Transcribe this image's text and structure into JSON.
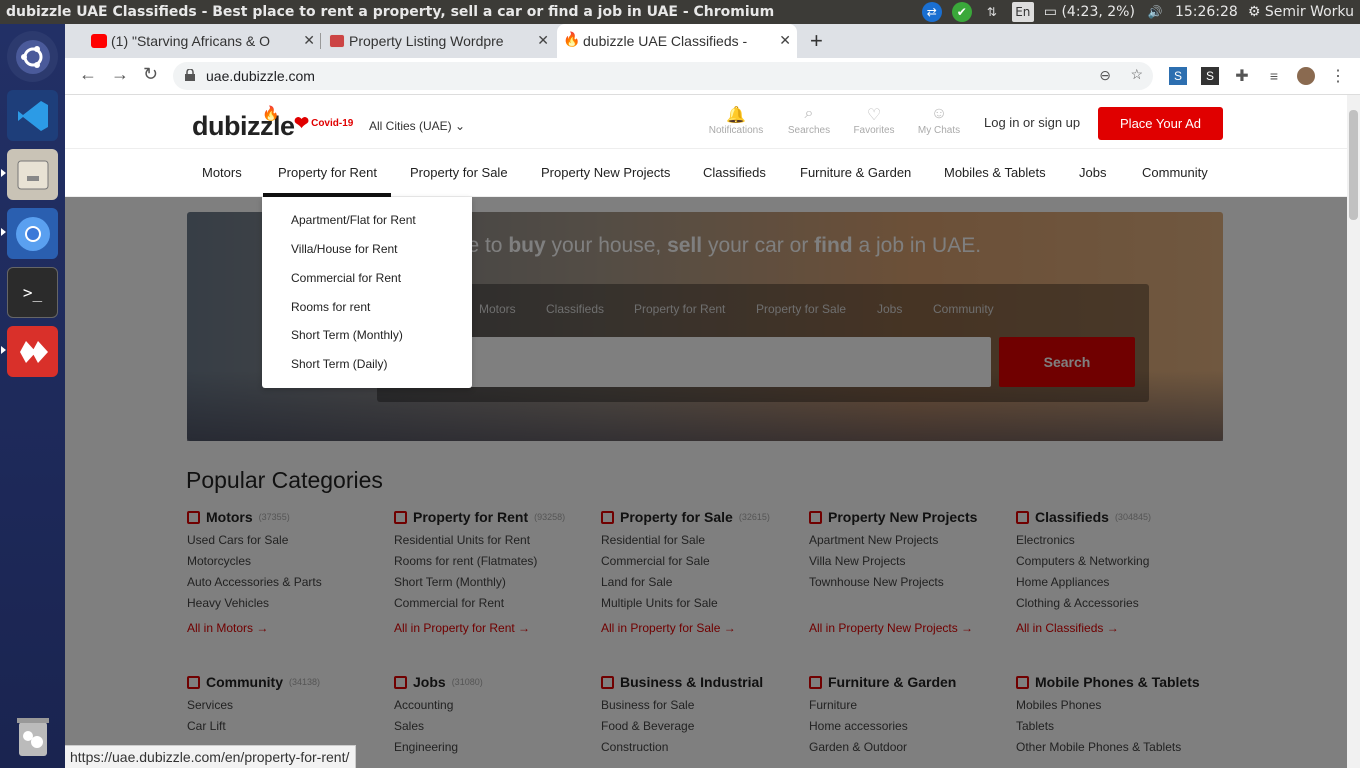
{
  "window": {
    "title": "dubizzle UAE Classifieds - Best place to rent a property, sell a car or find a job in UAE - Chromium",
    "tray": {
      "lang": "En",
      "battery": "(4:23, 2%)",
      "time": "15:26:28",
      "user": "Semir Worku"
    }
  },
  "tabs": [
    {
      "label": "(1) \"Starving Africans & O",
      "favicon_color": "#ff0000"
    },
    {
      "label": "Property Listing Wordpre",
      "favicon_color": "#d44"
    },
    {
      "label": "dubizzle UAE Classifieds -",
      "favicon_color": "#e00000"
    }
  ],
  "omnibox": {
    "url": "uae.dubizzle.com"
  },
  "site": {
    "logo": "dubizzle",
    "covid": "Covid-19",
    "city_selector": "All Cities (UAE)",
    "header_icons": [
      {
        "label": "Notifications",
        "icon": "bell-icon",
        "glyph": "🔔"
      },
      {
        "label": "Searches",
        "icon": "search-icon",
        "glyph": "⌕"
      },
      {
        "label": "Favorites",
        "icon": "heart-icon",
        "glyph": "♡"
      },
      {
        "label": "My Chats",
        "icon": "chat-icon",
        "glyph": "☺"
      }
    ],
    "login": "Log in or sign up",
    "place_ad": "Place Your Ad",
    "nav": [
      "Motors",
      "Property for Rent",
      "Property for Sale",
      "Property New Projects",
      "Classifieds",
      "Furniture & Garden",
      "Mobiles & Tablets",
      "Jobs",
      "Community"
    ],
    "dropdown": [
      "Apartment/Flat for Rent",
      "Villa/House for Rent",
      "Commercial for Rent",
      "Rooms for rent",
      "Short Term (Monthly)",
      "Short Term (Daily)"
    ],
    "hero": {
      "tag_prefix": "place to ",
      "tag_buy": "buy",
      "tag_mid1": " your house, ",
      "tag_sell": "sell",
      "tag_mid2": " your car or ",
      "tag_find": "find",
      "tag_suffix": " a job in UAE.",
      "panel_tabs": [
        "Motors",
        "Classifieds",
        "Property for Rent",
        "Property for Sale",
        "Jobs",
        "Community"
      ],
      "search_button": "Search"
    },
    "popular_title": "Popular Categories",
    "categories_row1": [
      {
        "title": "Motors",
        "count": "(37355)",
        "links": [
          "Used Cars for Sale",
          "Motorcycles",
          "Auto Accessories & Parts",
          "Heavy Vehicles"
        ],
        "all": "All in Motors →"
      },
      {
        "title": "Property for Rent",
        "count": "(93258)",
        "links": [
          "Residential Units for Rent",
          "Rooms for rent (Flatmates)",
          "Short Term (Monthly)",
          "Commercial for Rent"
        ],
        "all": "All in Property for Rent →"
      },
      {
        "title": "Property for Sale",
        "count": "(32615)",
        "links": [
          "Residential for Sale",
          "Commercial for Sale",
          "Land for Sale",
          "Multiple Units for Sale"
        ],
        "all": "All in Property for Sale →"
      },
      {
        "title": "Property New Projects",
        "count": "",
        "links": [
          "Apartment New Projects",
          "Villa New Projects",
          "Townhouse New Projects",
          ""
        ],
        "all": "All in Property New Projects →"
      },
      {
        "title": "Classifieds",
        "count": "(304845)",
        "links": [
          "Electronics",
          "Computers & Networking",
          "Home Appliances",
          "Clothing & Accessories"
        ],
        "all": "All in Classifieds →"
      }
    ],
    "categories_row2": [
      {
        "title": "Community",
        "count": "(34138)",
        "links": [
          "Services",
          "Car Lift"
        ]
      },
      {
        "title": "Jobs",
        "count": "(31080)",
        "links": [
          "Accounting",
          "Sales",
          "Engineering"
        ]
      },
      {
        "title": "Business & Industrial",
        "count": "",
        "links": [
          "Business for Sale",
          "Food & Beverage",
          "Construction"
        ]
      },
      {
        "title": "Furniture & Garden",
        "count": "",
        "links": [
          "Furniture",
          "Home accessories",
          "Garden & Outdoor"
        ]
      },
      {
        "title": "Mobile Phones & Tablets",
        "count": "",
        "links": [
          "Mobiles Phones",
          "Tablets",
          "Other Mobile Phones & Tablets"
        ]
      }
    ]
  },
  "status_url": "https://uae.dubizzle.com/en/property-for-rent/"
}
